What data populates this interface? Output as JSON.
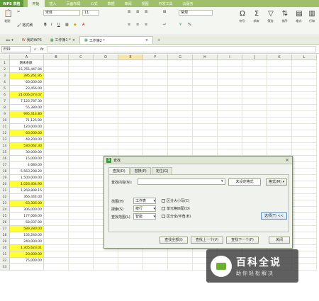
{
  "titlebar": {
    "app_name": "WPS 表格",
    "menus": [
      "开始",
      "插入",
      "页面布局",
      "公式",
      "数据",
      "审阅",
      "视图",
      "开发工具",
      "云服务"
    ],
    "active_menu": "开始"
  },
  "ribbon": {
    "paste": "粘贴·",
    "cut": "✂",
    "format_painter": "格式刷",
    "font_name": "宋体",
    "font_size": "11",
    "bold": "B",
    "italic": "I",
    "underline": "U",
    "number_format": "常规",
    "symbol": "符号·",
    "sum": "求和·",
    "filter": "筛选·",
    "sort": "排序·",
    "format": "格式·",
    "row_col": "行和"
  },
  "doc_tabs": [
    {
      "label": "我的WPS",
      "active": false
    },
    {
      "label": "工作簿1 *",
      "active": false
    },
    {
      "label": "工作簿2 *",
      "active": true
    }
  ],
  "formula_bar": {
    "cell_ref": "E39",
    "fx": "fx"
  },
  "columns": [
    "A",
    "B",
    "C",
    "D",
    "E",
    "F",
    "G",
    "H",
    "I",
    "J",
    "K",
    "L"
  ],
  "header_cell": "期末余额",
  "rows": [
    {
      "n": "1",
      "a": "期末余额",
      "hl": false
    },
    {
      "n": "2",
      "a": "15,765,447.04",
      "hl": false
    },
    {
      "n": "3",
      "a": "395,261.95",
      "hl": true
    },
    {
      "n": "4",
      "a": "60,000.00",
      "hl": false
    },
    {
      "n": "5",
      "a": "23,456.00",
      "hl": false
    },
    {
      "n": "6",
      "a": "21,006,073.07",
      "hl": true
    },
    {
      "n": "7",
      "a": "7,123,787.30",
      "hl": false
    },
    {
      "n": "8",
      "a": "55,380.00",
      "hl": false
    },
    {
      "n": "9",
      "a": "995,314.80",
      "hl": true
    },
    {
      "n": "10",
      "a": "71,125.00",
      "hl": false
    },
    {
      "n": "11",
      "a": "120,000.00",
      "hl": false
    },
    {
      "n": "12",
      "a": "60,000.00",
      "hl": true
    },
    {
      "n": "13",
      "a": "49,200.00",
      "hl": false
    },
    {
      "n": "14",
      "a": "530,062.30",
      "hl": true
    },
    {
      "n": "15",
      "a": "30,000.00",
      "hl": false
    },
    {
      "n": "16",
      "a": "15,000.00",
      "hl": false
    },
    {
      "n": "17",
      "a": "4,680.00",
      "hl": false
    },
    {
      "n": "18",
      "a": "5,563,298.20",
      "hl": false
    },
    {
      "n": "19",
      "a": "1,500,000.00",
      "hl": false
    },
    {
      "n": "20",
      "a": "1,026,404.90",
      "hl": true
    },
    {
      "n": "21",
      "a": "1,269,808.15",
      "hl": false
    },
    {
      "n": "22",
      "a": "366,444.00",
      "hl": false
    },
    {
      "n": "23",
      "a": "63,305.00",
      "hl": true
    },
    {
      "n": "24",
      "a": "306,000.00",
      "hl": false
    },
    {
      "n": "25",
      "a": "177,066.00",
      "hl": false
    },
    {
      "n": "26",
      "a": "58,037.00",
      "hl": false
    },
    {
      "n": "27",
      "a": "589,280.00",
      "hl": true
    },
    {
      "n": "28",
      "a": "156,240.00",
      "hl": false
    },
    {
      "n": "29",
      "a": "240,000.00",
      "hl": false
    },
    {
      "n": "30",
      "a": "1,305,623.01",
      "hl": true
    },
    {
      "n": "31",
      "a": "20,000.00",
      "hl": true
    },
    {
      "n": "32",
      "a": "75,000.00",
      "hl": false
    },
    {
      "n": "33",
      "a": "",
      "hl": false
    }
  ],
  "dialog": {
    "title": "查找",
    "tabs": [
      "查找(D)",
      "替换(P)",
      "定位(G)"
    ],
    "find_label": "查找内容(N):",
    "no_format": "未设定格式",
    "format_btn": "格式(M) ▾",
    "scope_label": "范围(H)",
    "scope_value": "工作表",
    "search_label": "搜索(S)",
    "search_value": "按行",
    "lookin_label": "查找范围(L)",
    "lookin_value": "智能",
    "opt_case": "区分大小写(C)",
    "opt_whole": "单元格匹配(O)",
    "opt_width": "区分全/半角(B)",
    "options_btn": "选项(T) <<",
    "find_all": "查找全部(I)",
    "find_prev": "查找上一个(V)",
    "find_next": "查找下一个(F)",
    "close": "关闭"
  },
  "watermark": {
    "main": "百科全说",
    "sub": "助你轻松解决"
  },
  "colors": {
    "highlight": "#ffff33",
    "titlebar": "#9fbf6a",
    "accent": "#5f9a3a"
  }
}
